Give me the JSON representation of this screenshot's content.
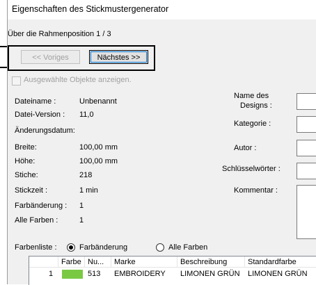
{
  "window": {
    "title": "Eigenschaften des Stickmustergenerator"
  },
  "frame_nav": {
    "position_label": "Über die Rahmenposition 1 / 3",
    "prev_label": "<< Voriges",
    "next_label": "Nächstes >>",
    "show_selected_label": "Ausgewählte Objekte anzeigen."
  },
  "info": {
    "rows": [
      {
        "label": "Dateiname :",
        "value": "Unbenannt"
      },
      {
        "label": "Datei-Version :",
        "value": "11,0"
      },
      {
        "label": "Änderungsdatum:",
        "value": ""
      },
      {
        "label": "Breite:",
        "value": "100,00 mm"
      },
      {
        "label": "Höhe:",
        "value": "100,00 mm"
      },
      {
        "label": "Stiche:",
        "value": "218"
      },
      {
        "label": "Stickzeit :",
        "value": "1 min"
      },
      {
        "label": "Farbänderung :",
        "value": "1"
      },
      {
        "label": "Alle Farben :",
        "value": "1"
      }
    ]
  },
  "right_fields": {
    "design_name_label_1": "Name des",
    "design_name_label_2": "Designs :",
    "category_label": "Kategorie :",
    "author_label": "Autor :",
    "keywords_label": "Schlüsselwörter :",
    "comment_label": "Kommentar :"
  },
  "color_list": {
    "label": "Farbenliste :",
    "option_change": "Farbänderung",
    "option_all": "Alle Farben",
    "selected": "Farbänderung",
    "columns": [
      "Farbe",
      "Nu...",
      "Marke",
      "Beschreibung",
      "Standardfarbe"
    ],
    "rows": [
      {
        "index": "1",
        "color": "#7ac943",
        "number": "513",
        "brand": "EMBROIDERY",
        "description": "LIMONEN GRÜN",
        "default_color": "LIMONEN GRÜN"
      }
    ]
  }
}
